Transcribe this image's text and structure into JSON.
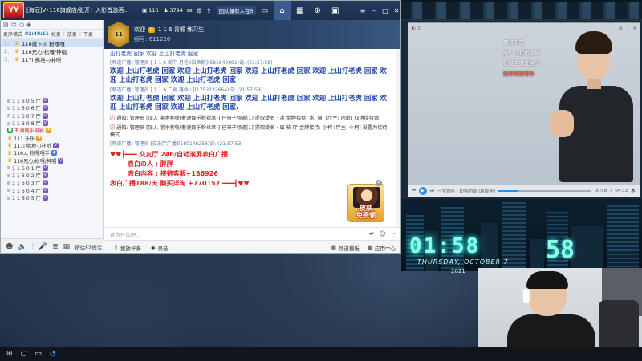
{
  "app": {
    "logo_text": "YY",
    "title": "[海冠]V•116旗舰店/张开：入影首选酒...",
    "stats": {
      "viewers": "116",
      "members": "3794"
    },
    "channel_chip": "团队兼有人在5",
    "nav": {
      "home": "⌂",
      "grid": "▦",
      "game": "⊕",
      "bag": "▣"
    }
  },
  "left_panel": {
    "mode_label": "麦序模式",
    "timer": "02:48:11",
    "actions": [
      "抢麦",
      "放麦",
      "下麦"
    ],
    "ranks": [
      {
        "num": "1.",
        "name": "116撒卜火 粉嘎嘎",
        "selected": true
      },
      {
        "num": "2.",
        "name": "116兄心/松嘎/神唱",
        "selected": false
      },
      {
        "num": "3.",
        "name": "117i 佛地--/补听",
        "selected": false
      }
    ],
    "users": [
      {
        "prefix": "",
        "name": "1 1 6 0 5 厅",
        "badge": "",
        "hl": false
      },
      {
        "prefix": "",
        "name": "1 1 6 0 6 厅",
        "badge": "",
        "hl": false
      },
      {
        "prefix": "",
        "name": "1 1 6 0 7 厅",
        "badge": "",
        "hl": false
      },
      {
        "prefix": "",
        "name": "1 1 6 0 8 厅",
        "badge": "",
        "hl": false
      },
      {
        "prefix": "",
        "name": "五湖娱乐摄影",
        "badge": "",
        "hl": true
      },
      {
        "prefix": "",
        "name": "111 乐乐",
        "badge": "",
        "hl": false
      },
      {
        "prefix": "",
        "name": "117i 佛地·-/补听",
        "badge": "",
        "hl": false
      },
      {
        "prefix": "",
        "name": "116大 粉嘎嘎手",
        "badge": "",
        "hl": false
      },
      {
        "prefix": "",
        "name": "116兄心/松嘎/神唱",
        "badge": "",
        "hl": false
      },
      {
        "prefix": "",
        "name": "1 1 6 0 1 厅",
        "badge": "",
        "hl": false
      },
      {
        "prefix": "",
        "name": "1 1 6 0 2 厅",
        "badge": "",
        "hl": false
      },
      {
        "prefix": "",
        "name": "1 1 6 0 3 厅",
        "badge": "",
        "hl": false
      },
      {
        "prefix": "",
        "name": "1 1 6 0 4 厅",
        "badge": "",
        "hl": false
      },
      {
        "prefix": "",
        "name": "1 1 6 0 5 厅",
        "badge": "",
        "hl": false
      }
    ]
  },
  "room": {
    "welcome": "欢迎",
    "name": "1 1 6 青喉 练习生",
    "id_label": "频号: 611220"
  },
  "chat": {
    "top_text": "山打老虎 回家 欢迎 上山打老虎 回家",
    "msg1_meta": "[频道广播] 管理员 [ 1 1 6 湖中 月桂0白鱼鹅](581849891)说: (21:57:58)",
    "msg1_text": "欢迎 上山打老虎 回家 欢迎 上山打老虎 回家 欢迎 上山打老虎 回家 欢迎 上山打老虎 回家 欢迎 上山打老虎 回家 欢迎 上山打老虎 回家",
    "msg2_meta": "[频道广播] 管理员 [ 1 1 6 二霸 落命☆](1752232664)说: (21:57:58)",
    "msg2_text": "欢迎 上山打老虎 回家 欢迎 上山打老虎 回家 欢迎 上山打老虎 回家 欢迎 上山打老虎 回家 欢迎 上山打老虎 回家 欢迎 上山打老虎 回家.",
    "notice1": "通知: 管理员 [加入 溜冰者嘞(奢速娱乐粉丝席)] 已将子频道[1] 提取受名 · 冰 金牌接待: 水. 啵. [厅主: 团南] 取消接待请",
    "notice2": "通知: 管理员 [加入 溜冰者嘞(奢速娱乐粉丝席)] 已将子频道[1] 提取受名 · 眉 枝 厅 金牌接待: 小柯 [厅主: 小柯] 设置为接待模式",
    "promo_meta": "[频道广播] 管理员 [交友厅广播](580146258)说: (21:57:53)",
    "promo_line1_a": "♥♥┣━━━ 交友厅",
    "promo_line1_b": "24h/自动滚屏表白广播",
    "promo_l2_label": "表白の人 :",
    "promo_l2_val": "胖胖",
    "promo_l3_label": "表白内容 :",
    "promo_l3_val": "接待客服+186926",
    "promo_l4": "表白广播188/天 购买详询 +770157 ━━━┫♥♥",
    "skin_ad": "皮肤\n免费领",
    "input_placeholder": "说点什么吧..."
  },
  "toolbar": {
    "left1": "播放伴奏",
    "left2": "录音",
    "left_strip": "按住F2说话",
    "r1": "频道模板",
    "r2": "应用中心"
  },
  "music_player": {
    "lyrics": [
      "即将的夜",
      "多少让我再重振",
      "让星空见证挑战",
      "回来吧我等你"
    ],
    "track": "一生冒险 - 即将的夜 (原版伴奏)",
    "time_now": "00:58",
    "time_total": "04:33",
    "progress": 0.21
  },
  "overlay_clock": {
    "time": "01:58",
    "time2": "58",
    "date": "THURSDAY, OCTOBER 7",
    "year": "2021"
  }
}
